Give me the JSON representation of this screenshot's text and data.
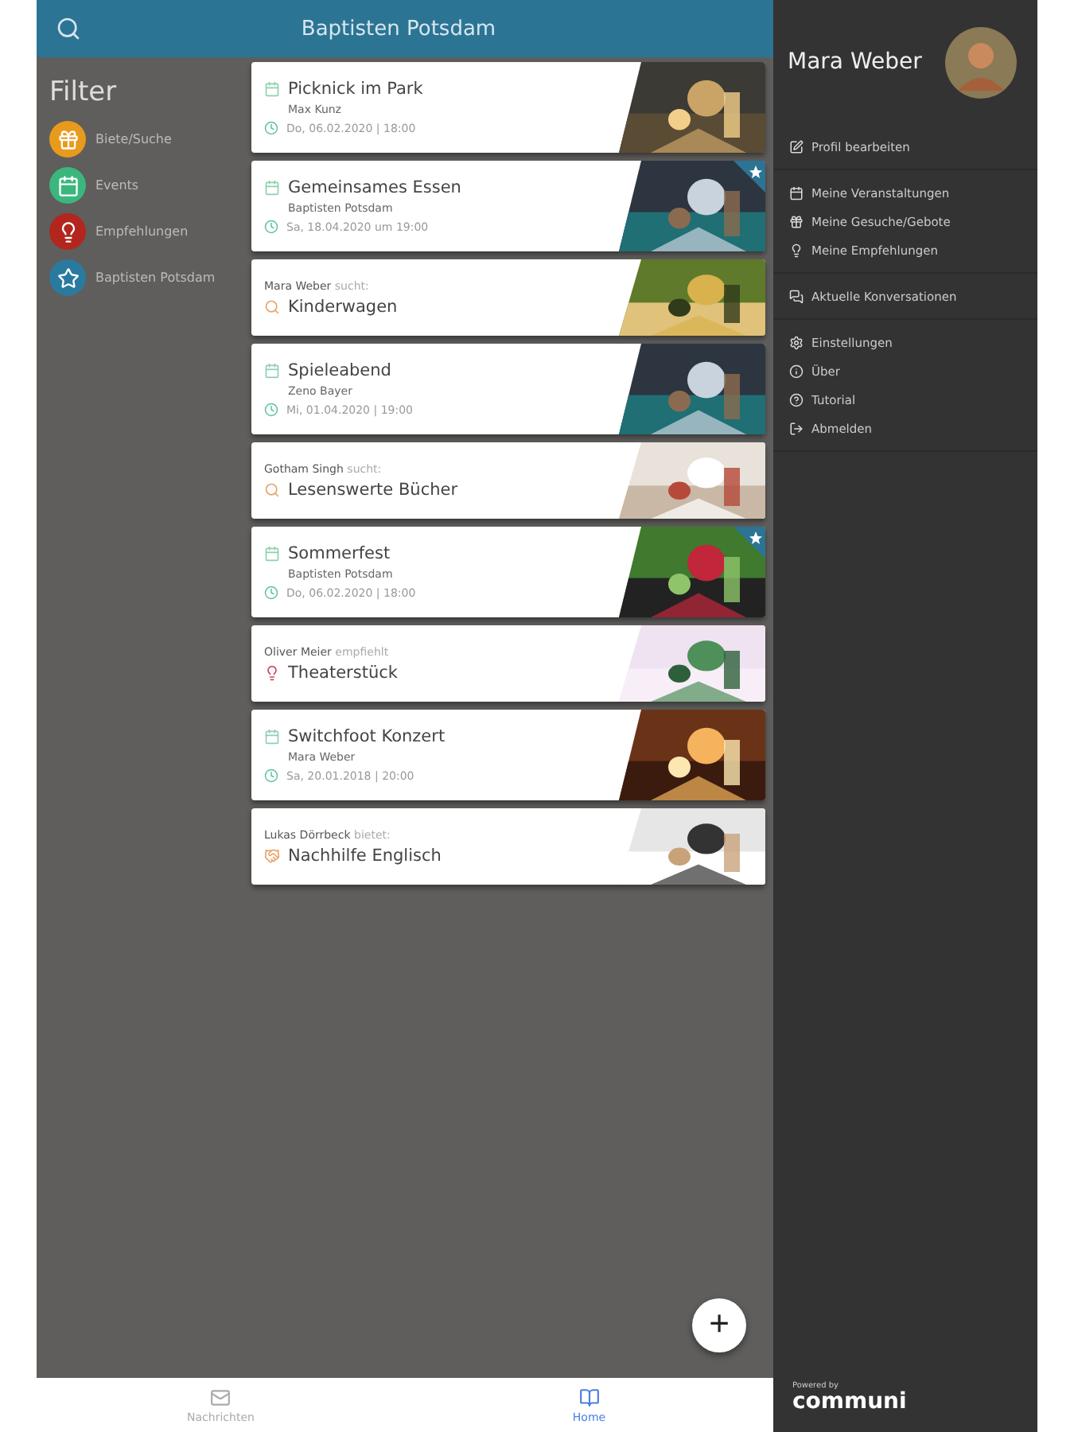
{
  "header": {
    "title": "Baptisten Potsdam"
  },
  "filter": {
    "title": "Filter",
    "items": [
      {
        "label": "Biete/Suche",
        "kind": "gift",
        "color": "#e89a1c"
      },
      {
        "label": "Events",
        "kind": "calendar",
        "color": "#3bb77e"
      },
      {
        "label": "Empfehlungen",
        "kind": "bulb",
        "color": "#b3261e"
      },
      {
        "label": "Baptisten Potsdam",
        "kind": "star",
        "color": "#2a7aa0"
      }
    ]
  },
  "cards": [
    {
      "kind": "event",
      "title": "Picknick im Park",
      "subtitle": "Max Kunz",
      "date": "Do, 06.02.2020 | 18:00",
      "starred": false
    },
    {
      "kind": "event",
      "title": "Gemeinsames Essen",
      "subtitle": "Baptisten Potsdam",
      "date": "Sa, 18.04.2020 um 19:00",
      "starred": true
    },
    {
      "kind": "request",
      "author": "Mara Weber",
      "verb": "sucht:",
      "title": "Kinderwagen"
    },
    {
      "kind": "event",
      "title": "Spieleabend",
      "subtitle": "Zeno Bayer",
      "date": "Mi, 01.04.2020 | 19:00",
      "starred": false
    },
    {
      "kind": "request",
      "author": "Gotham Singh",
      "verb": "sucht:",
      "title": "Lesenswerte Bücher"
    },
    {
      "kind": "event",
      "title": "Sommerfest",
      "subtitle": "Baptisten Potsdam",
      "date": "Do, 06.02.2020 | 18:00",
      "starred": true
    },
    {
      "kind": "recommendation",
      "author": "Oliver Meier",
      "verb": "empfiehlt",
      "title": "Theaterstück"
    },
    {
      "kind": "event",
      "title": "Switchfoot Konzert",
      "subtitle": "Mara Weber",
      "date": "Sa, 20.01.2018 | 20:00",
      "starred": false
    },
    {
      "kind": "offer",
      "author": "Lukas Dörrbeck",
      "verb": "bietet:",
      "title": "Nachhilfe Englisch"
    }
  ],
  "fab": {
    "label": "+"
  },
  "nav": [
    {
      "label": "Nachrichten",
      "kind": "mail",
      "selected": false
    },
    {
      "label": "Home",
      "kind": "home",
      "selected": true
    }
  ],
  "drawer": {
    "name": "Mara Weber",
    "groups": [
      [
        {
          "label": "Profil bearbeiten",
          "kind": "edit"
        }
      ],
      [
        {
          "label": "Meine Veranstaltungen",
          "kind": "calendar"
        },
        {
          "label": "Meine Gesuche/Gebote",
          "kind": "gift"
        },
        {
          "label": "Meine Empfehlungen",
          "kind": "bulb"
        }
      ],
      [
        {
          "label": "Aktuelle Konversationen",
          "kind": "chats"
        }
      ],
      [
        {
          "label": "Einstellungen",
          "kind": "gear"
        },
        {
          "label": "Über",
          "kind": "info"
        },
        {
          "label": "Tutorial",
          "kind": "help"
        },
        {
          "label": "Abmelden",
          "kind": "logout"
        }
      ]
    ],
    "powered": "Powered by",
    "logo": "communi"
  }
}
